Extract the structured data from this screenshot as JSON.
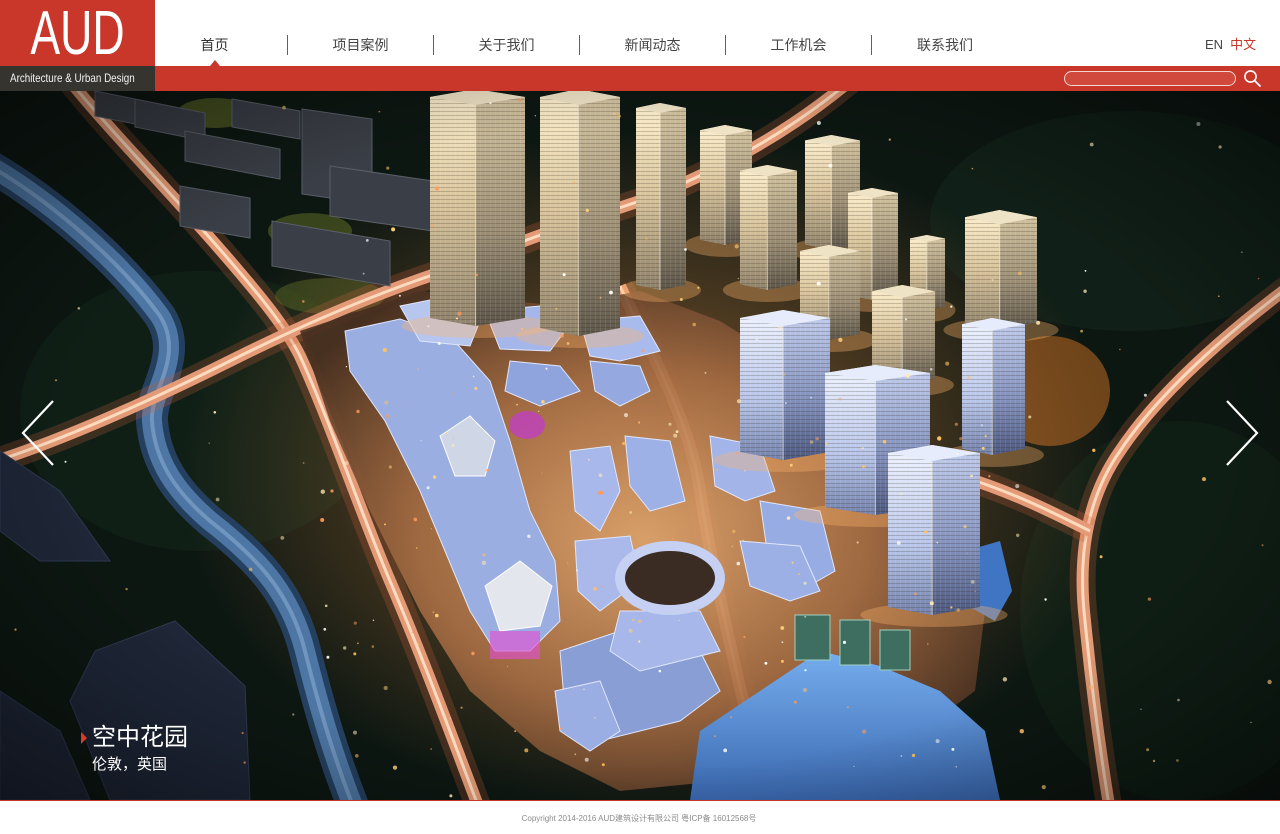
{
  "brand": {
    "logo_text": "AUD",
    "tagline": "Architecture & Urban Design"
  },
  "nav": {
    "items": [
      {
        "label": "首页",
        "active": true
      },
      {
        "label": "项目案例",
        "active": false
      },
      {
        "label": "关于我们",
        "active": false
      },
      {
        "label": "新闻动态",
        "active": false
      },
      {
        "label": "工作机会",
        "active": false
      },
      {
        "label": "联系我们",
        "active": false
      }
    ]
  },
  "language": {
    "options": [
      {
        "label": "EN",
        "active": false
      },
      {
        "label": "中文",
        "active": true
      }
    ]
  },
  "search": {
    "value": "",
    "placeholder": "",
    "icon": "search-icon"
  },
  "hero": {
    "title": "空中花园",
    "subtitle": "伦敦，英国",
    "prev_icon": "chevron-left-icon",
    "next_icon": "chevron-right-icon",
    "caption_icon": "triangle-right-icon"
  },
  "footer": {
    "copyright": "Copyright 2014-2016 AUD建筑设计有限公司 粤ICP备 16012568号"
  },
  "colors": {
    "brand_red": "#c8372a",
    "nav_text": "#444444",
    "footer_text": "#8a8a8a"
  }
}
